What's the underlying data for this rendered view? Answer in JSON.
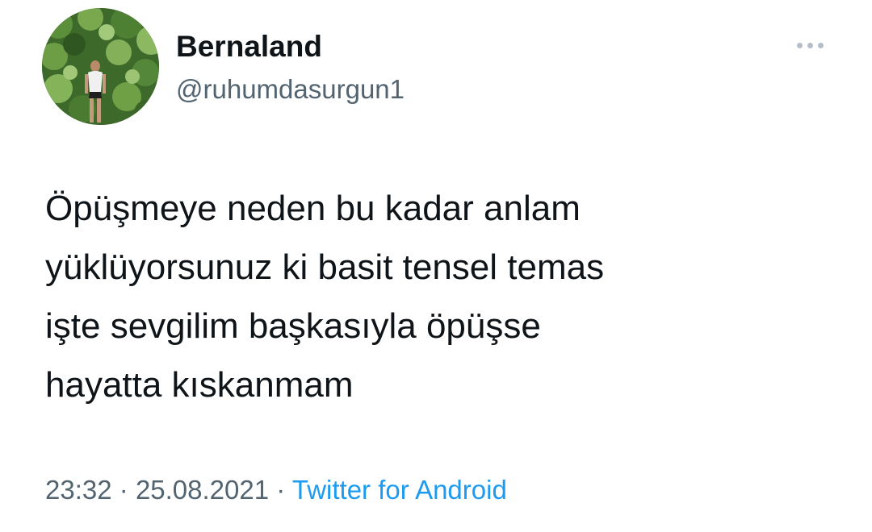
{
  "user": {
    "display_name": "Bernaland",
    "handle": "@ruhumdasurgun1"
  },
  "tweet": {
    "text_lines": [
      "Öpüşmeye neden bu kadar anlam",
      "yüklüyorsunuz ki basit tensel temas",
      "işte sevgilim başkasıyla öpüşse",
      "hayatta kıskanmam"
    ],
    "time": "23:32",
    "date": "25.08.2021",
    "separator": "·",
    "source": "Twitter for Android"
  },
  "icons": {
    "more": "more-horizontal-icon"
  },
  "colors": {
    "text": "#0f1419",
    "secondary": "#536471",
    "link": "#1d9bf0",
    "menu_dots": "#b5bec7"
  }
}
